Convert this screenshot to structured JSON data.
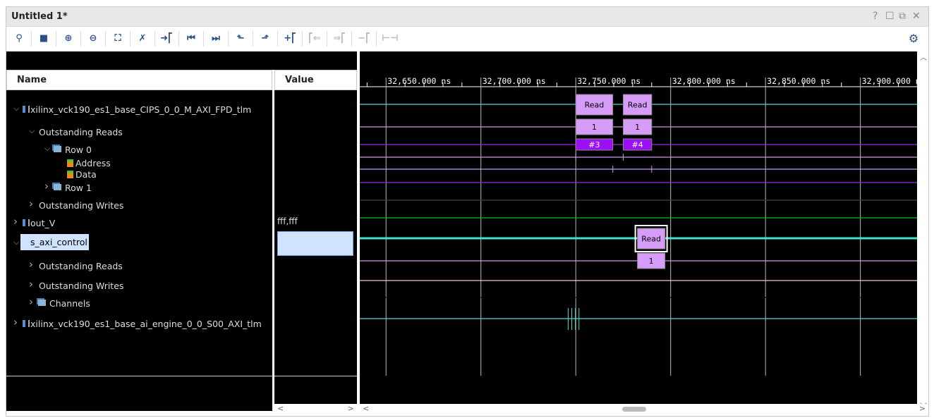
{
  "window": {
    "title": "Untitled 1*",
    "controls": [
      "?",
      "☐",
      "⧉",
      "✕"
    ]
  },
  "toolbar": {
    "buttons": [
      {
        "name": "search-icon",
        "glyph": "⚲",
        "enabled": true
      },
      {
        "name": "save-icon",
        "glyph": "■",
        "enabled": true
      },
      {
        "name": "zoom-in-icon",
        "glyph": "⊕",
        "enabled": true
      },
      {
        "name": "zoom-out-icon",
        "glyph": "⊖",
        "enabled": true
      },
      {
        "name": "zoom-fit-icon",
        "glyph": "⛶",
        "enabled": true
      },
      {
        "name": "cursor-snap-icon",
        "glyph": "✗",
        "enabled": true
      },
      {
        "name": "go-to-time-icon",
        "glyph": "➜⎡",
        "enabled": true
      },
      {
        "name": "go-to-start-icon",
        "glyph": "⏮",
        "enabled": true
      },
      {
        "name": "go-to-end-icon",
        "glyph": "⏭",
        "enabled": true
      },
      {
        "name": "previous-transition-icon",
        "glyph": "⬑",
        "enabled": true
      },
      {
        "name": "next-transition-icon",
        "glyph": "⬏",
        "enabled": true
      },
      {
        "name": "add-marker-icon",
        "glyph": "+⎡",
        "enabled": true
      },
      {
        "name": "previous-marker-icon",
        "glyph": "⎡⇐",
        "enabled": false
      },
      {
        "name": "next-marker-icon",
        "glyph": "⇒⎡",
        "enabled": false
      },
      {
        "name": "delete-marker-icon",
        "glyph": "−⎡",
        "enabled": false
      },
      {
        "name": "swap-cursors-icon",
        "glyph": "⊢⊣",
        "enabled": false
      }
    ],
    "settings": "gear-icon"
  },
  "headers": {
    "name": "Name",
    "value": "Value"
  },
  "tree": [
    {
      "label": "xilinx_vck190_es1_base_CIPS_0_0_M_AXI_FPD_tlm",
      "indent": 0,
      "chev": "v",
      "icon": "bus",
      "value": ""
    },
    {
      "label": "Outstanding Reads",
      "indent": 1,
      "chev": "v",
      "icon": "",
      "value": ""
    },
    {
      "label": "Row 0",
      "indent": 2,
      "chev": "v",
      "icon": "group",
      "value": ""
    },
    {
      "label": "Address",
      "indent": 3,
      "chev": "",
      "icon": "signal",
      "value": ""
    },
    {
      "label": "Data",
      "indent": 3,
      "chev": "",
      "icon": "signal",
      "value": ""
    },
    {
      "label": "Row 1",
      "indent": 2,
      "chev": ">",
      "icon": "group",
      "value": ""
    },
    {
      "label": "Outstanding Writes",
      "indent": 1,
      "chev": ">",
      "icon": "",
      "value": ""
    },
    {
      "label": "out_V",
      "indent": 0,
      "chev": ">",
      "icon": "bus",
      "value": "fff,fff"
    },
    {
      "label": "s_axi_control",
      "indent": 0,
      "chev": "v",
      "icon": "bus",
      "value": "",
      "selected": true
    },
    {
      "label": "Outstanding Reads",
      "indent": 1,
      "chev": ">",
      "icon": "",
      "value": ""
    },
    {
      "label": "Outstanding Writes",
      "indent": 1,
      "chev": ">",
      "icon": "",
      "value": ""
    },
    {
      "label": "Channels",
      "indent": 1,
      "chev": ">",
      "icon": "group",
      "value": ""
    },
    {
      "label": "xilinx_vck190_es1_base_ai_engine_0_0_S00_AXI_tlm",
      "indent": 0,
      "chev": ">",
      "icon": "bus",
      "value": ""
    }
  ],
  "timeline": {
    "unit": "ns",
    "start": 32639.5,
    "end": 32929.5,
    "major_ticks": [
      "32,650.000 ns",
      "32,700.000 ns",
      "32,750.000 ns",
      "32,800.000 ns",
      "32,850.000 ns",
      "32,900.000 ns"
    ],
    "major_values": [
      32650,
      32700,
      32750,
      32800,
      32850,
      32900
    ]
  },
  "waves": [
    {
      "color": "#40e0d0",
      "boxes": [
        {
          "t0": 32750,
          "t1": 32769.5,
          "label": "Read",
          "fill": "#d59cf8"
        },
        {
          "t0": 32775,
          "t1": 32790,
          "label": "Read",
          "fill": "#d59cf8"
        }
      ]
    },
    {
      "color": "#c89ae8",
      "boxes": [
        {
          "t0": 32750,
          "t1": 32769.5,
          "label": "1",
          "fill": "#d59cf8"
        },
        {
          "t0": 32775,
          "t1": 32790,
          "label": "1",
          "fill": "#d59cf8"
        }
      ]
    },
    {
      "color": "#9a2be2",
      "boxes": [
        {
          "t0": 32750,
          "t1": 32769.5,
          "label": "#3",
          "fill": "#9b10f5",
          "text": "#fff"
        },
        {
          "t0": 32775,
          "t1": 32790,
          "label": "#4",
          "fill": "#9b10f5",
          "text": "#fff"
        }
      ]
    },
    {
      "color": "#c89ae8",
      "ticks": [
        32750,
        32775
      ]
    },
    {
      "color": "#c89ae8",
      "ticks": [
        32769.5,
        32790
      ]
    },
    {
      "color": "#9a2be2"
    },
    {
      "color": "#444"
    },
    {
      "color": "#00c800"
    },
    {
      "color": "#40e0d0",
      "thick": true,
      "boxes": [
        {
          "t0": 32782.5,
          "t1": 32797,
          "label": "Read",
          "fill": "#d59cf8",
          "selected": true
        }
      ]
    },
    {
      "color": "#c89ae8",
      "boxes": [
        {
          "t0": 32782.5,
          "t1": 32797,
          "label": "1",
          "fill": "#d59cf8"
        }
      ]
    },
    {
      "color": "#f0c8d0"
    },
    {
      "color": "#000"
    },
    {
      "color": "#40e0d0",
      "bursts": [
        32746,
        32747,
        32748,
        32749
      ]
    }
  ]
}
